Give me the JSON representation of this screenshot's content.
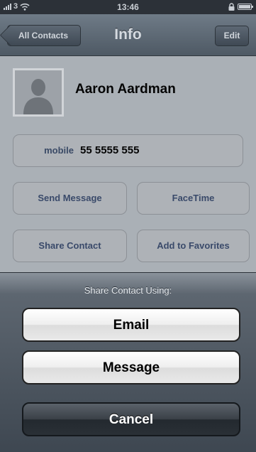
{
  "status_bar": {
    "carrier": "3",
    "time": "13:46"
  },
  "nav": {
    "back_label": "All Contacts",
    "title": "Info",
    "edit_label": "Edit"
  },
  "contact": {
    "name": "Aaron Aardman",
    "phone_label": "mobile",
    "phone_number": "55 5555 555"
  },
  "actions": {
    "send_message": "Send Message",
    "facetime": "FaceTime",
    "share_contact": "Share Contact",
    "add_to_favorites": "Add to Favorites"
  },
  "action_sheet": {
    "title": "Share Contact Using:",
    "email": "Email",
    "message": "Message",
    "cancel": "Cancel"
  },
  "icons": [
    "signal-icon",
    "wifi-icon",
    "lock-icon",
    "battery-icon",
    "person-silhouette-icon"
  ]
}
